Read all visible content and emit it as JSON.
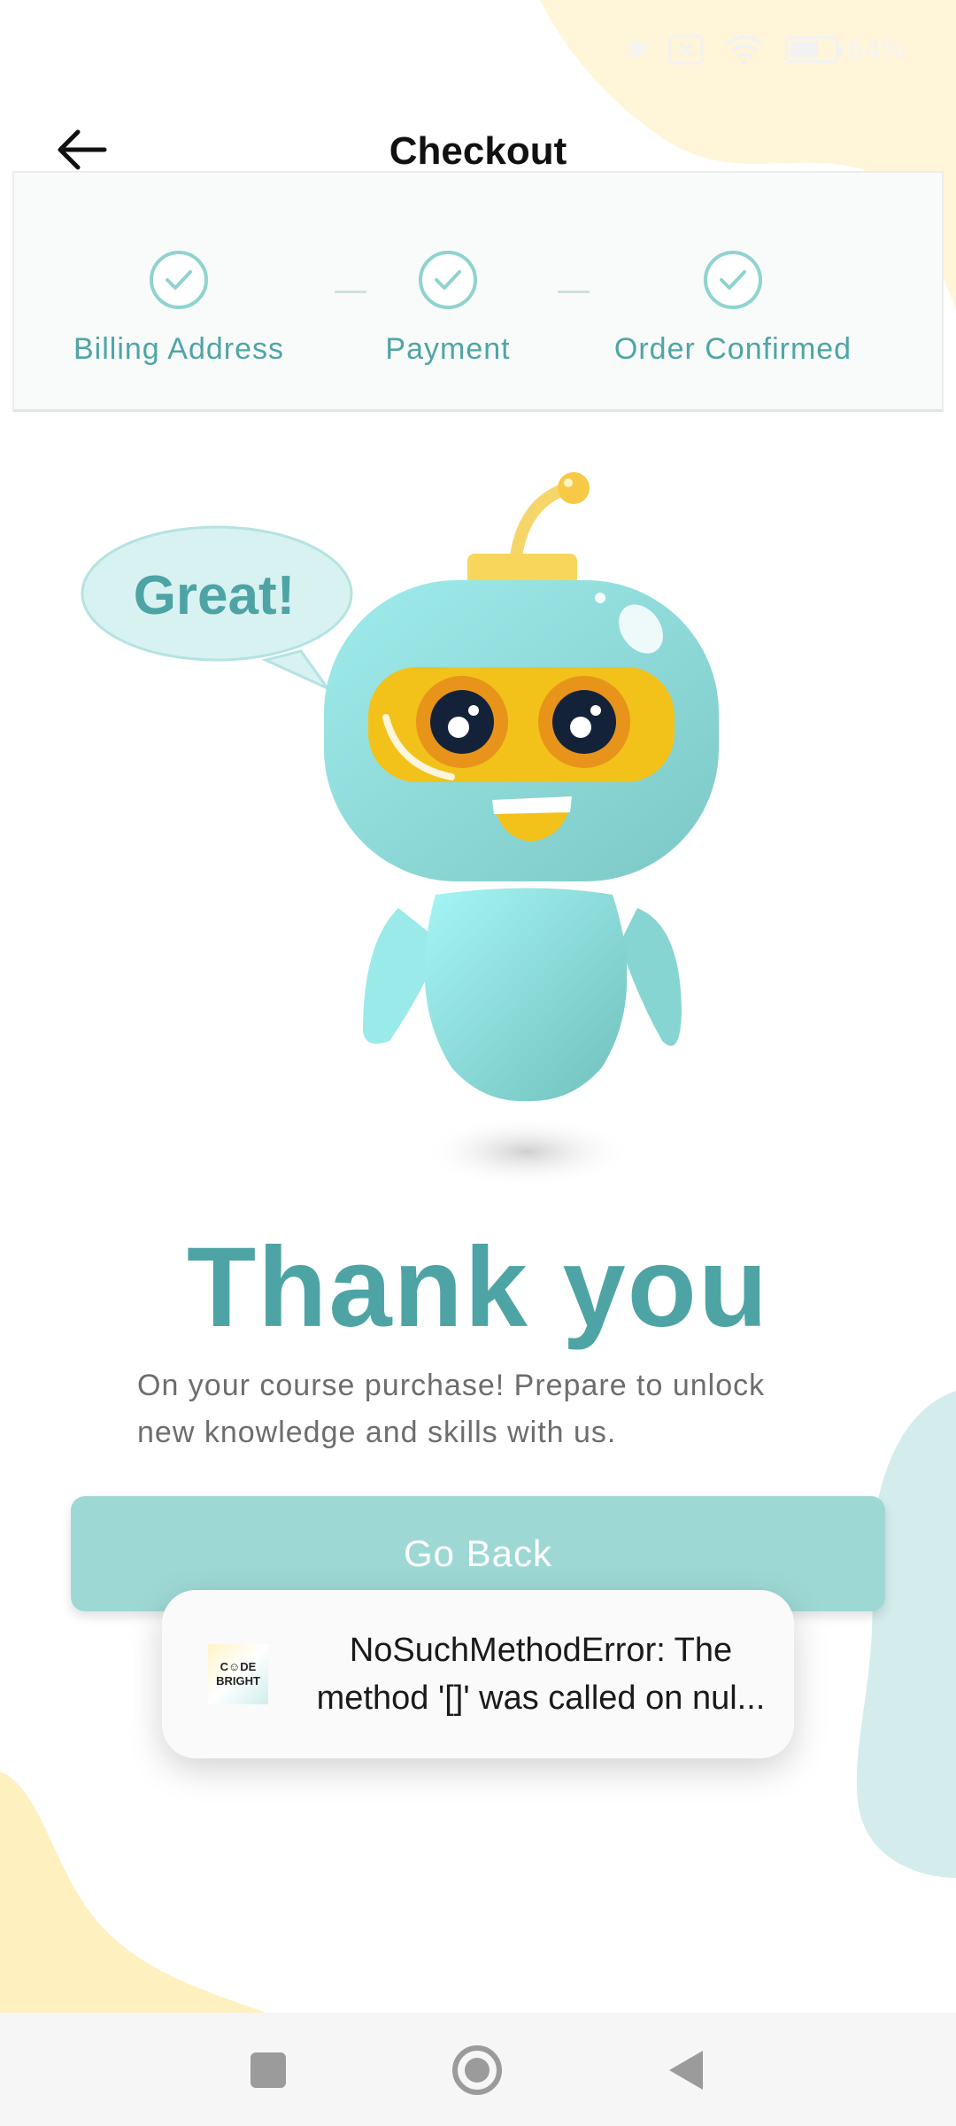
{
  "status_bar": {
    "battery_text": "64%",
    "battery_level": 0.64
  },
  "header": {
    "title": "Checkout",
    "back_icon": "arrow-left-icon"
  },
  "stepper": {
    "steps": [
      {
        "label": "Billing Address",
        "done": true
      },
      {
        "label": "Payment",
        "done": true
      },
      {
        "label": "Order Confirmed",
        "done": true
      }
    ]
  },
  "illustration": {
    "speech_bubble": "Great!"
  },
  "main": {
    "heading": "Thank you",
    "message": "On your course purchase! Prepare to unlock new knowledge and skills with us.",
    "go_back_label": "Go Back"
  },
  "toast": {
    "logo_line1": "C☺DE",
    "logo_line2": "BRIGHT",
    "message": "NoSuchMethodError: The method '[]' was called on nul..."
  },
  "colors": {
    "accent": "#4ea4a4",
    "button": "#9ed8d5",
    "stepper_bg": "#f8fbfa"
  }
}
